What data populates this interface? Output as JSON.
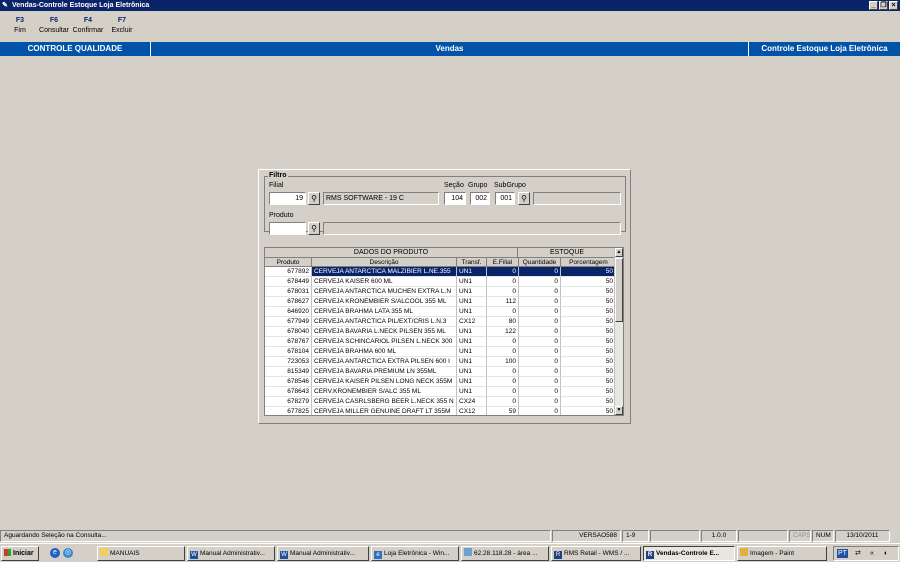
{
  "window": {
    "title": "Vendas-Controle Estoque Loja Eletrônica"
  },
  "toolbar": [
    {
      "key": "F3",
      "label": "Fim"
    },
    {
      "key": "F6",
      "label": "Consultar"
    },
    {
      "key": "F4",
      "label": "Confirmar"
    },
    {
      "key": "F7",
      "label": "Excluir"
    }
  ],
  "header": {
    "left": "CONTROLE QUALIDADE",
    "center": "Vendas",
    "right": "Controle Estoque Loja Eletrônica"
  },
  "filter": {
    "title": "Filtro",
    "filial_label": "Filial",
    "filial_value": "19",
    "filial_name": "RMS SOFTWARE  - 19 C",
    "secao_label": "Seção",
    "secao_value": "104",
    "grupo_label": "Grupo",
    "grupo_value": "002",
    "subgrupo_label": "SubGrupo",
    "subgrupo_value": "001",
    "subgrupo_desc": "",
    "produto_label": "Produto",
    "produto_value": "",
    "produto_desc": ""
  },
  "grid": {
    "group_headers": [
      "DADOS DO PRODUTO",
      "ESTOQUE"
    ],
    "columns": [
      "Produto",
      "Descrição",
      "Transf.",
      "E.Filial",
      "Quantidade",
      "Porcentagem"
    ],
    "rows": [
      [
        "677892",
        "CERVEJA ANTARCTICA MALZIBIER L.NE.355",
        "UN1",
        "0",
        "0",
        "50"
      ],
      [
        "678449",
        "CERVEJA KAISER 600 ML",
        "UN1",
        "0",
        "0",
        "50"
      ],
      [
        "678031",
        "CERVEJA ANTARCTICA MUCHEN EXTRA L.N",
        "UN1",
        "0",
        "0",
        "50"
      ],
      [
        "678627",
        "CERVEJA KRONEMBIER S/ALCOOL 355 ML",
        "UN1",
        "112",
        "0",
        "50"
      ],
      [
        "646920",
        "CERVEJA BRAHMA LATA 355 ML",
        "UN1",
        "0",
        "0",
        "50"
      ],
      [
        "677949",
        "CERVEJA ANTARCTICA PIL/EXT/CRIS L.N.3",
        "CX12",
        "80",
        "0",
        "50"
      ],
      [
        "678040",
        "CERVEJA BAVARIA L.NECK PILSEN 355 ML",
        "UN1",
        "122",
        "0",
        "50"
      ],
      [
        "678767",
        "CERVEJA SCHINCARIOL PILSEN L.NECK 300",
        "UN1",
        "0",
        "0",
        "50"
      ],
      [
        "678104",
        "CERVEJA BRAHMA 600 ML",
        "UN1",
        "0",
        "0",
        "50"
      ],
      [
        "723053",
        "CERVEJA ANTARCTICA EXTRA PILSEN 600 I",
        "UN1",
        "100",
        "0",
        "50"
      ],
      [
        "815349",
        "CERVEJA BAVARIA PREMIUM LN 355ML",
        "UN1",
        "0",
        "0",
        "50"
      ],
      [
        "678546",
        "CERVEJA KAISER PILSEN LONG NECK 355M",
        "UN1",
        "0",
        "0",
        "50"
      ],
      [
        "678643",
        "CERV.KRONEMBIER S/ALC 355 ML",
        "UN1",
        "0",
        "0",
        "50"
      ],
      [
        "678279",
        "CERVEJA CASRLSBERG BEER L.NECK 355 N",
        "CX24",
        "0",
        "0",
        "50"
      ],
      [
        "677825",
        "CERVEJA MILLER GENUINE DRAFT LT 355M",
        "CX12",
        "59",
        "0",
        "50"
      ]
    ]
  },
  "status": {
    "message": "Aguardando Seleção na Consulta...",
    "version": "VERSAO588",
    "range": "1-9",
    "build": "1.0.0",
    "caps": "CAPS",
    "num": "NUM",
    "date": "13/10/2011"
  },
  "taskbar": {
    "start": "Iniciar",
    "tasks": [
      "MANUAIS",
      "Manual Administrativ...",
      "Manual Administrativ...",
      "Loja Eletrônica - Win...",
      "62.28.118.28 - área ...",
      "RMS Retail - WMS / ...",
      "Vendas-Controle E...",
      "Imagem - Paint"
    ],
    "lang": "PT"
  }
}
